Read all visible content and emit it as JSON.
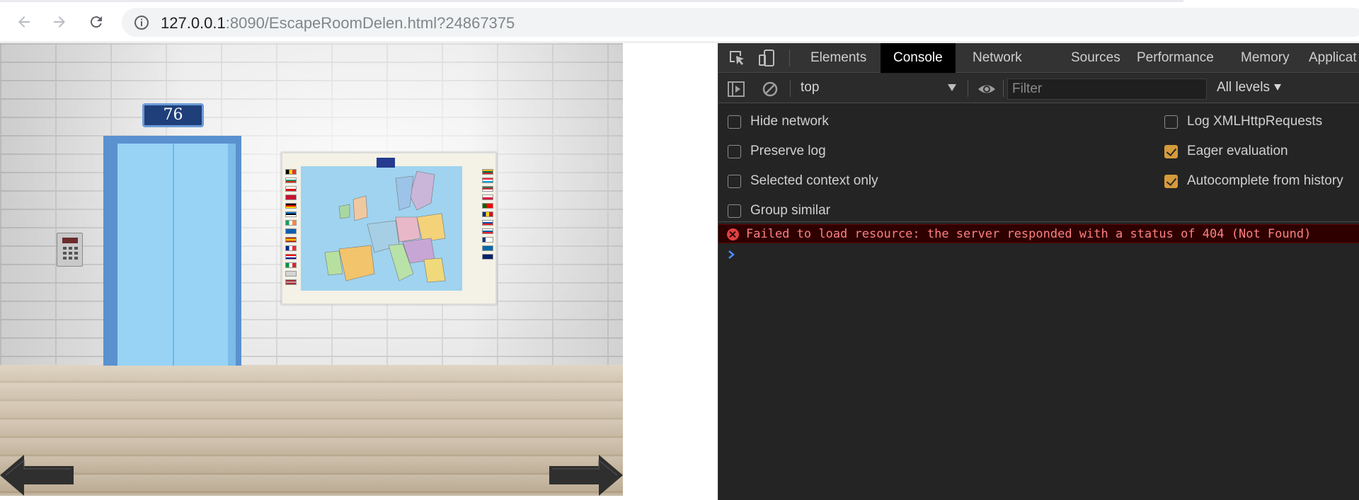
{
  "browser": {
    "url_host": "127.0.0.1",
    "url_rest": ":8090/EscapeRoomDelen.html?24867375",
    "icons": {
      "back": "back-arrow-icon",
      "forward": "forward-arrow-icon",
      "reload": "reload-icon",
      "info": "info-icon"
    }
  },
  "scene": {
    "room_number": "76",
    "colors": {
      "elevator_frame": "#5a91cf",
      "elevator_door": "#98d3f6",
      "sign_bg": "#1f3f7a"
    },
    "icons": {
      "left": "left-arrow-icon",
      "right": "right-arrow-icon",
      "keypad": "keypad-icon",
      "map": "europe-map-icon"
    }
  },
  "devtools": {
    "tabs": [
      {
        "label": "Elements",
        "active": false
      },
      {
        "label": "Console",
        "active": true
      },
      {
        "label": "Network",
        "active": false
      },
      {
        "label": "Sources",
        "active": false
      },
      {
        "label": "Performance",
        "active": false
      },
      {
        "label": "Memory",
        "active": false
      },
      {
        "label": "Applicat",
        "active": false
      }
    ],
    "context": "top",
    "filter_placeholder": "Filter",
    "levels": "All levels",
    "settings": {
      "hide_network": {
        "label": "Hide network",
        "checked": false
      },
      "preserve_log": {
        "label": "Preserve log",
        "checked": false
      },
      "selected_context": {
        "label": "Selected context only",
        "checked": false
      },
      "group_similar": {
        "label": "Group similar",
        "checked": false
      },
      "log_xhr": {
        "label": "Log XMLHttpRequests",
        "checked": false
      },
      "eager_eval": {
        "label": "Eager evaluation",
        "checked": true
      },
      "autocomplete": {
        "label": "Autocomplete from history",
        "checked": true
      }
    },
    "messages": [
      {
        "level": "error",
        "text": "Failed to load resource: the server responded with a status of 404 (Not Found)"
      }
    ],
    "colors": {
      "error_bg": "#2e0000",
      "error_text": "#ff8080",
      "checkbox_checked": "#d59a3b"
    }
  }
}
